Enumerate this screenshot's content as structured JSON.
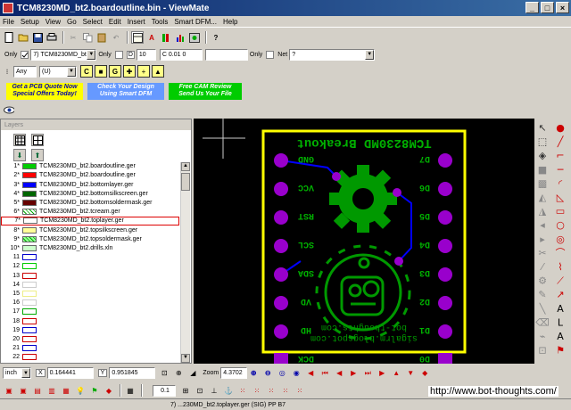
{
  "window": {
    "title": "TCM8230MD_bt2.boardoutline.bin - ViewMate"
  },
  "menu": [
    "File",
    "Setup",
    "View",
    "Go",
    "Select",
    "Edit",
    "Insert",
    "Tools",
    "Smart DFM...",
    "Help"
  ],
  "filterbar": {
    "only1": "Only",
    "layer_select": "7) TCM8230MD_bt",
    "only2": "Only",
    "dcode_label": "D",
    "dcode_value": "10",
    "size_value": "C 0.01 0",
    "only3": "Only",
    "net_label": "Net",
    "net_value": "?"
  },
  "filterbar2": {
    "any_select": "Any",
    "u_select": "(U)"
  },
  "banners": [
    {
      "line1": "Get a PCB Quote Now",
      "line2": "Special Offers Today!",
      "color": "#ffff00",
      "text": "#0000aa"
    },
    {
      "line1": "Check Your Design",
      "line2": "Using Smart DFM",
      "color": "#6699ff",
      "text": "#ffffff"
    },
    {
      "line1": "Free CAM Review",
      "line2": "Send Us Your File",
      "color": "#00cc00",
      "text": "#ffffff"
    }
  ],
  "layers_panel": {
    "header": "Layers"
  },
  "layers": [
    {
      "num": "1*",
      "name": "TCM8230MD_bt2.boardoutline.ger",
      "color": "#00cc00"
    },
    {
      "num": "2*",
      "name": "TCM8230MD_bt2.boardoutline.ger",
      "color": "#ff0000"
    },
    {
      "num": "3*",
      "name": "TCM8230MD_bt2.bottomlayer.ger",
      "color": "#0000ff"
    },
    {
      "num": "4*",
      "name": "TCM8230MD_bt2.bottomsilkscreen.ger",
      "color": "#006600"
    },
    {
      "num": "5*",
      "name": "TCM8230MD_bt2.bottomsoldermask.ger",
      "color": "#660000"
    },
    {
      "num": "6*",
      "name": "TCM8230MD_bt2.tcream.ger",
      "color": "#ffffff"
    },
    {
      "num": "7*",
      "name": "TCM8230MD_bt2.toplayer.ger",
      "color": "#ffffff"
    },
    {
      "num": "8*",
      "name": "TCM8230MD_bt2.topsilkscreen.ger",
      "color": "#ffff99"
    },
    {
      "num": "9*",
      "name": "TCM8230MD_bt2.topsoldermask.ger",
      "color": "#99ff99"
    },
    {
      "num": "10*",
      "name": "TCM8230MD_bt2.drills.xln",
      "color": "#ccffcc"
    },
    {
      "num": "11",
      "name": "",
      "color": "#ffffff"
    },
    {
      "num": "12",
      "name": "",
      "color": "#ffffff"
    },
    {
      "num": "13",
      "name": "",
      "color": "#ffffff"
    },
    {
      "num": "14",
      "name": "",
      "color": "#ffffff"
    },
    {
      "num": "15",
      "name": "",
      "color": "#ffffff"
    },
    {
      "num": "16",
      "name": "",
      "color": "#ffffff"
    },
    {
      "num": "17",
      "name": "",
      "color": "#ffffff"
    },
    {
      "num": "18",
      "name": "",
      "color": "#ffffff"
    },
    {
      "num": "19",
      "name": "",
      "color": "#ffffff"
    },
    {
      "num": "20",
      "name": "",
      "color": "#ffffff"
    },
    {
      "num": "21",
      "name": "",
      "color": "#ffffff"
    },
    {
      "num": "22",
      "name": "",
      "color": "#ffffff"
    }
  ],
  "board": {
    "title": "TCM8230MD Breakout",
    "website1": "bot-thoughts.com",
    "website2": "sigalrm.blogspot.com",
    "left_labels": [
      "GND",
      "VCC",
      "RST",
      "SCL",
      "SDA",
      "VD",
      "HD",
      "DCK"
    ],
    "right_labels": [
      "D7",
      "D6",
      "D5",
      "D4",
      "D3",
      "D2",
      "D1",
      "D0"
    ]
  },
  "coords": {
    "unit": "inch",
    "x_label": "X",
    "x_value": "0.164441",
    "y_label": "Y",
    "y_value": "0.951845",
    "zoom_label": "Zoom",
    "zoom_value": "4.3702",
    "grid_value": "0.1"
  },
  "status": {
    "text": "7) ...230MD_bt2.toplayer.ger (SIG) PP B7"
  },
  "watermark": "http://www.bot-thoughts.com/"
}
